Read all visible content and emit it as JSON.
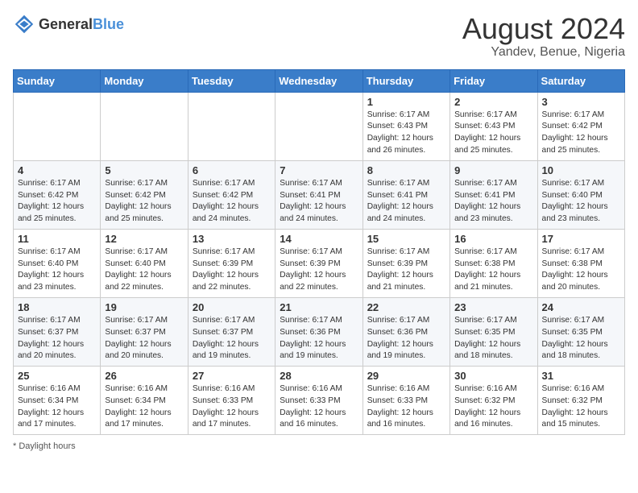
{
  "header": {
    "logo_general": "General",
    "logo_blue": "Blue",
    "month_title": "August 2024",
    "location": "Yandev, Benue, Nigeria"
  },
  "days_of_week": [
    "Sunday",
    "Monday",
    "Tuesday",
    "Wednesday",
    "Thursday",
    "Friday",
    "Saturday"
  ],
  "footer": {
    "daylight_label": "Daylight hours"
  },
  "weeks": [
    [
      {
        "day": "",
        "sunrise": "",
        "sunset": "",
        "daylight": ""
      },
      {
        "day": "",
        "sunrise": "",
        "sunset": "",
        "daylight": ""
      },
      {
        "day": "",
        "sunrise": "",
        "sunset": "",
        "daylight": ""
      },
      {
        "day": "",
        "sunrise": "",
        "sunset": "",
        "daylight": ""
      },
      {
        "day": "1",
        "sunrise": "Sunrise: 6:17 AM",
        "sunset": "Sunset: 6:43 PM",
        "daylight": "Daylight: 12 hours and 26 minutes."
      },
      {
        "day": "2",
        "sunrise": "Sunrise: 6:17 AM",
        "sunset": "Sunset: 6:43 PM",
        "daylight": "Daylight: 12 hours and 25 minutes."
      },
      {
        "day": "3",
        "sunrise": "Sunrise: 6:17 AM",
        "sunset": "Sunset: 6:42 PM",
        "daylight": "Daylight: 12 hours and 25 minutes."
      }
    ],
    [
      {
        "day": "4",
        "sunrise": "Sunrise: 6:17 AM",
        "sunset": "Sunset: 6:42 PM",
        "daylight": "Daylight: 12 hours and 25 minutes."
      },
      {
        "day": "5",
        "sunrise": "Sunrise: 6:17 AM",
        "sunset": "Sunset: 6:42 PM",
        "daylight": "Daylight: 12 hours and 25 minutes."
      },
      {
        "day": "6",
        "sunrise": "Sunrise: 6:17 AM",
        "sunset": "Sunset: 6:42 PM",
        "daylight": "Daylight: 12 hours and 24 minutes."
      },
      {
        "day": "7",
        "sunrise": "Sunrise: 6:17 AM",
        "sunset": "Sunset: 6:41 PM",
        "daylight": "Daylight: 12 hours and 24 minutes."
      },
      {
        "day": "8",
        "sunrise": "Sunrise: 6:17 AM",
        "sunset": "Sunset: 6:41 PM",
        "daylight": "Daylight: 12 hours and 24 minutes."
      },
      {
        "day": "9",
        "sunrise": "Sunrise: 6:17 AM",
        "sunset": "Sunset: 6:41 PM",
        "daylight": "Daylight: 12 hours and 23 minutes."
      },
      {
        "day": "10",
        "sunrise": "Sunrise: 6:17 AM",
        "sunset": "Sunset: 6:40 PM",
        "daylight": "Daylight: 12 hours and 23 minutes."
      }
    ],
    [
      {
        "day": "11",
        "sunrise": "Sunrise: 6:17 AM",
        "sunset": "Sunset: 6:40 PM",
        "daylight": "Daylight: 12 hours and 23 minutes."
      },
      {
        "day": "12",
        "sunrise": "Sunrise: 6:17 AM",
        "sunset": "Sunset: 6:40 PM",
        "daylight": "Daylight: 12 hours and 22 minutes."
      },
      {
        "day": "13",
        "sunrise": "Sunrise: 6:17 AM",
        "sunset": "Sunset: 6:39 PM",
        "daylight": "Daylight: 12 hours and 22 minutes."
      },
      {
        "day": "14",
        "sunrise": "Sunrise: 6:17 AM",
        "sunset": "Sunset: 6:39 PM",
        "daylight": "Daylight: 12 hours and 22 minutes."
      },
      {
        "day": "15",
        "sunrise": "Sunrise: 6:17 AM",
        "sunset": "Sunset: 6:39 PM",
        "daylight": "Daylight: 12 hours and 21 minutes."
      },
      {
        "day": "16",
        "sunrise": "Sunrise: 6:17 AM",
        "sunset": "Sunset: 6:38 PM",
        "daylight": "Daylight: 12 hours and 21 minutes."
      },
      {
        "day": "17",
        "sunrise": "Sunrise: 6:17 AM",
        "sunset": "Sunset: 6:38 PM",
        "daylight": "Daylight: 12 hours and 20 minutes."
      }
    ],
    [
      {
        "day": "18",
        "sunrise": "Sunrise: 6:17 AM",
        "sunset": "Sunset: 6:37 PM",
        "daylight": "Daylight: 12 hours and 20 minutes."
      },
      {
        "day": "19",
        "sunrise": "Sunrise: 6:17 AM",
        "sunset": "Sunset: 6:37 PM",
        "daylight": "Daylight: 12 hours and 20 minutes."
      },
      {
        "day": "20",
        "sunrise": "Sunrise: 6:17 AM",
        "sunset": "Sunset: 6:37 PM",
        "daylight": "Daylight: 12 hours and 19 minutes."
      },
      {
        "day": "21",
        "sunrise": "Sunrise: 6:17 AM",
        "sunset": "Sunset: 6:36 PM",
        "daylight": "Daylight: 12 hours and 19 minutes."
      },
      {
        "day": "22",
        "sunrise": "Sunrise: 6:17 AM",
        "sunset": "Sunset: 6:36 PM",
        "daylight": "Daylight: 12 hours and 19 minutes."
      },
      {
        "day": "23",
        "sunrise": "Sunrise: 6:17 AM",
        "sunset": "Sunset: 6:35 PM",
        "daylight": "Daylight: 12 hours and 18 minutes."
      },
      {
        "day": "24",
        "sunrise": "Sunrise: 6:17 AM",
        "sunset": "Sunset: 6:35 PM",
        "daylight": "Daylight: 12 hours and 18 minutes."
      }
    ],
    [
      {
        "day": "25",
        "sunrise": "Sunrise: 6:16 AM",
        "sunset": "Sunset: 6:34 PM",
        "daylight": "Daylight: 12 hours and 17 minutes."
      },
      {
        "day": "26",
        "sunrise": "Sunrise: 6:16 AM",
        "sunset": "Sunset: 6:34 PM",
        "daylight": "Daylight: 12 hours and 17 minutes."
      },
      {
        "day": "27",
        "sunrise": "Sunrise: 6:16 AM",
        "sunset": "Sunset: 6:33 PM",
        "daylight": "Daylight: 12 hours and 17 minutes."
      },
      {
        "day": "28",
        "sunrise": "Sunrise: 6:16 AM",
        "sunset": "Sunset: 6:33 PM",
        "daylight": "Daylight: 12 hours and 16 minutes."
      },
      {
        "day": "29",
        "sunrise": "Sunrise: 6:16 AM",
        "sunset": "Sunset: 6:33 PM",
        "daylight": "Daylight: 12 hours and 16 minutes."
      },
      {
        "day": "30",
        "sunrise": "Sunrise: 6:16 AM",
        "sunset": "Sunset: 6:32 PM",
        "daylight": "Daylight: 12 hours and 16 minutes."
      },
      {
        "day": "31",
        "sunrise": "Sunrise: 6:16 AM",
        "sunset": "Sunset: 6:32 PM",
        "daylight": "Daylight: 12 hours and 15 minutes."
      }
    ]
  ]
}
